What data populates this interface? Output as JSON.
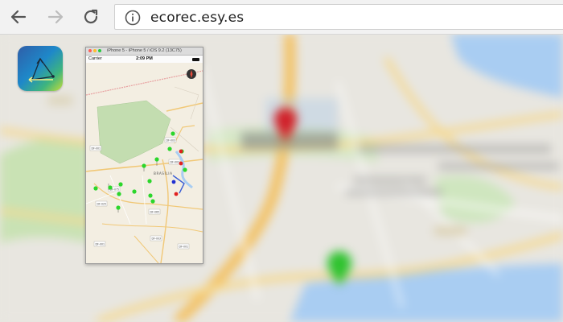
{
  "browser": {
    "url": "ecorec.esy.es",
    "back_icon": "back-arrow-icon",
    "forward_icon": "forward-arrow-icon",
    "reload_icon": "reload-icon",
    "info_icon": "info-icon"
  },
  "background_map": {
    "labels": [
      "Brasília",
      "Esplanada dos Ministérios",
      "Palácio do Planalto",
      "Congresso Nacional"
    ],
    "pins": [
      {
        "color": "#d32f2f",
        "name": "red-pin"
      },
      {
        "color": "#2ecc40",
        "name": "green-pin"
      }
    ]
  },
  "app_icon": {
    "name": "ecorec-app-icon"
  },
  "simulator": {
    "window_title": "iPhone 5 - iPhone 5 / iOS 9.2 (13C75)",
    "carrier": "Carrier",
    "time": "2:09 PM",
    "city_label": "BRASÍLIA",
    "road_labels": [
      "DF-001",
      "DF-003",
      "DF-002",
      "DF-075",
      "DF-025",
      "DF-065",
      "DF-003",
      "DF-001",
      "DF-001"
    ],
    "marker_colors": {
      "green": "#2bd62b",
      "red": "#e02020",
      "blue": "#1f2fd1"
    }
  }
}
